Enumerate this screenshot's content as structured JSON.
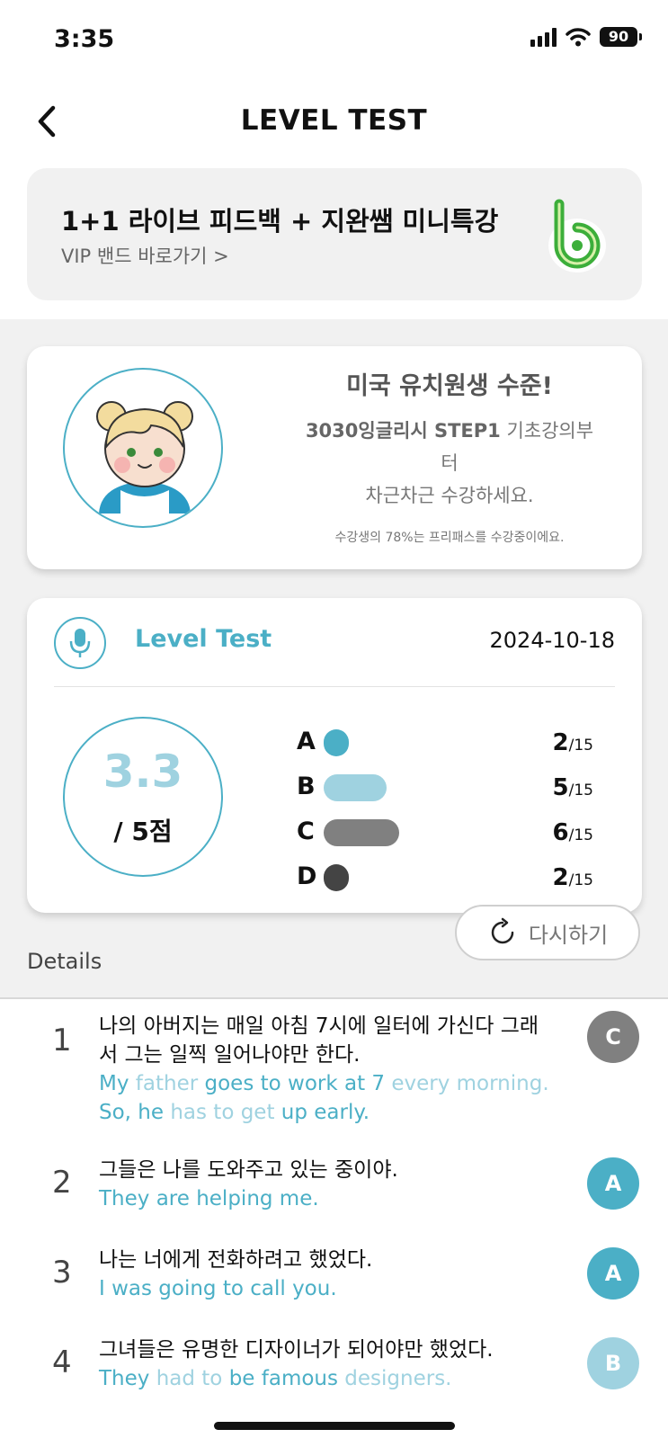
{
  "status_bar": {
    "time": "3:35",
    "battery": "90"
  },
  "nav": {
    "title": "LEVEL TEST"
  },
  "banner": {
    "title": "1+1 라이브 피드백 + 지완쌤 미니특강",
    "subtitle": "VIP 밴드 바로가기 >"
  },
  "level_card": {
    "title": "미국 유치원생 수준!",
    "desc_bold": "3030잉글리시 STEP1",
    "desc_rest_line1": " 기초강의부",
    "desc_line2": "터",
    "desc_line3": "차근차근 수강하세요.",
    "note": "수강생의 78%는 프리패스를 수강중이에요."
  },
  "test_card": {
    "label": "Level Test",
    "date": "2024-10-18",
    "score": "3.3",
    "score_unit": "/ 5점",
    "grades": [
      {
        "letter": "A",
        "count": "2",
        "total": "/15",
        "fraction": 0.133,
        "color": "#4bafc6"
      },
      {
        "letter": "B",
        "count": "5",
        "total": "/15",
        "fraction": 0.333,
        "color": "#9fd2e0"
      },
      {
        "letter": "C",
        "count": "6",
        "total": "/15",
        "fraction": 0.4,
        "color": "#808080"
      },
      {
        "letter": "D",
        "count": "2",
        "total": "/15",
        "fraction": 0.133,
        "color": "#444444"
      }
    ]
  },
  "details": {
    "label": "Details",
    "retry_label": "다시하기"
  },
  "questions": [
    {
      "num": "1",
      "ko": "나의 아버지는 매일 아침 7시에 일터에 가신다 그래서 그는 일찍 일어나야만 한다.",
      "en_parts": [
        {
          "t": "My ",
          "hl": true
        },
        {
          "t": "father ",
          "hl": false
        },
        {
          "t": "goes to work at 7 ",
          "hl": true
        },
        {
          "t": "every morning.",
          "hl": false
        },
        {
          "t": " So, he ",
          "hl": true
        },
        {
          "t": "has to get ",
          "hl": false
        },
        {
          "t": "up early.",
          "hl": true
        }
      ],
      "grade": "C",
      "grade_color": "#808080"
    },
    {
      "num": "2",
      "ko": "그들은 나를 도와주고 있는 중이야.",
      "en_parts": [
        {
          "t": "They are helping me.",
          "hl": true
        }
      ],
      "grade": "A",
      "grade_color": "#4bafc6"
    },
    {
      "num": "3",
      "ko": "나는 너에게 전화하려고 했었다.",
      "en_parts": [
        {
          "t": "I was going to call you.",
          "hl": true
        }
      ],
      "grade": "A",
      "grade_color": "#4bafc6"
    },
    {
      "num": "4",
      "ko": "그녀들은 유명한 디자이너가 되어야만 했었다.",
      "en_parts": [
        {
          "t": "They ",
          "hl": true
        },
        {
          "t": "had to ",
          "hl": false
        },
        {
          "t": "be famous ",
          "hl": true
        },
        {
          "t": "designers.",
          "hl": false
        }
      ],
      "grade": "B",
      "grade_color": "#9fd2e0"
    }
  ]
}
